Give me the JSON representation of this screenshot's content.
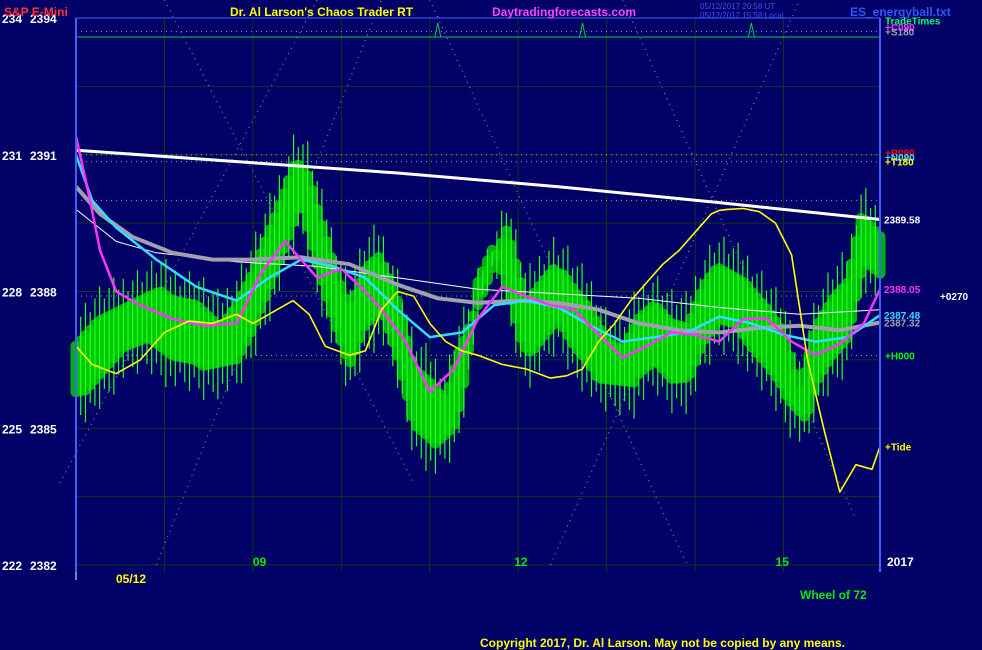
{
  "header": {
    "instrument": "S&P E-Mini",
    "app_title": "Dr. Al Larson's Chaos Trader RT",
    "website": "Daytradingforecasts.com",
    "timestamp_ut": "05/12/2017 20:58 UT",
    "timestamp_local": "05/12/2017 15:58 Local",
    "file": "ES_energyball.txt"
  },
  "footer": {
    "copyright": "Copyright 2017, Dr. Al Larson. May not be copied by any means.",
    "wheel": "Wheel of 72",
    "year": "2017",
    "date": "05/12"
  },
  "colors": {
    "background": "#000066",
    "price": "#00dd00",
    "ball": "#00cc00",
    "yellow": "#ffff00",
    "magenta": "#ff33ff",
    "cyan": "#33ddff",
    "gray": "#a0a0b0",
    "white": "#ffffff",
    "time_marker": "#00cc44"
  },
  "chart_data": {
    "type": "line",
    "xlabel": "",
    "ylabel": "",
    "ylim": [
      2382,
      2394
    ],
    "x_ticks": [
      "09",
      "12",
      "15"
    ],
    "y_ticks": [
      {
        "wheel": "222",
        "price": "2382",
        "value": 2382
      },
      {
        "wheel": "225",
        "price": "2385",
        "value": 2385
      },
      {
        "wheel": "228",
        "price": "2388",
        "value": 2388
      },
      {
        "wheel": "231",
        "price": "2391",
        "value": 2391
      },
      {
        "wheel": "234",
        "price": "2394",
        "value": 2394
      }
    ],
    "right_labels": [
      {
        "text": "TradeTimes",
        "value": 2393.95,
        "color": "#00ff66"
      },
      {
        "text": "+C090",
        "value": 2393.8,
        "color": "#ff33ff"
      },
      {
        "text": "+S180",
        "value": 2393.7,
        "color": "#a0a0b0"
      },
      {
        "text": "+R090",
        "value": 2391.05,
        "color": "#ff0000"
      },
      {
        "text": "+N090",
        "value": 2390.95,
        "color": "#33ddff"
      },
      {
        "text": "+T180",
        "value": 2390.85,
        "color": "#ffff00"
      },
      {
        "text": "2389.58",
        "value": 2389.58,
        "color": "#ffffff"
      },
      {
        "text": "2388.05",
        "value": 2388.05,
        "color": "#ff33ff"
      },
      {
        "text": "+0270",
        "value": 2387.9,
        "color": "#ffffff"
      },
      {
        "text": "2387.48",
        "value": 2387.48,
        "color": "#33ddff"
      },
      {
        "text": "2387.32",
        "value": 2387.32,
        "color": "#a0a0b0"
      },
      {
        "text": "+H000",
        "value": 2386.6,
        "color": "#00ff00"
      },
      {
        "text": "+Tide",
        "value": 2384.6,
        "color": "#ffff00"
      }
    ],
    "series": [
      {
        "key": "white",
        "x": [
          0,
          0.2,
          0.4,
          0.6,
          0.8,
          1
        ],
        "values": [
          2391.1,
          2390.85,
          2390.6,
          2390.3,
          2389.95,
          2389.58
        ]
      },
      {
        "key": "whitethin",
        "x": [
          0,
          0.05,
          0.1,
          0.2,
          0.3,
          0.4,
          0.5,
          0.6,
          0.7,
          0.8,
          0.9,
          1
        ],
        "values": [
          2389.8,
          2389.1,
          2388.85,
          2388.65,
          2388.55,
          2388.3,
          2388.05,
          2387.95,
          2387.85,
          2387.65,
          2387.5,
          2387.6
        ]
      },
      {
        "key": "gray",
        "x": [
          0,
          0.03,
          0.07,
          0.12,
          0.17,
          0.22,
          0.28,
          0.34,
          0.4,
          0.45,
          0.5,
          0.55,
          0.6,
          0.65,
          0.7,
          0.75,
          0.8,
          0.85,
          0.9,
          0.95,
          1
        ],
        "values": [
          2390.3,
          2389.7,
          2389.2,
          2388.85,
          2388.7,
          2388.7,
          2388.75,
          2388.6,
          2388.15,
          2387.85,
          2387.75,
          2387.8,
          2387.75,
          2387.6,
          2387.3,
          2387.15,
          2387.1,
          2387.2,
          2387.25,
          2387.15,
          2387.32
        ]
      },
      {
        "key": "cyan",
        "x": [
          0,
          0.02,
          0.05,
          0.1,
          0.15,
          0.2,
          0.24,
          0.28,
          0.32,
          0.36,
          0.4,
          0.44,
          0.48,
          0.52,
          0.56,
          0.6,
          0.64,
          0.68,
          0.72,
          0.76,
          0.8,
          0.84,
          0.88,
          0.92,
          0.96,
          1
        ],
        "values": [
          2391.0,
          2390.0,
          2389.4,
          2388.7,
          2388.1,
          2387.8,
          2388.3,
          2388.7,
          2388.55,
          2388.3,
          2387.6,
          2387.0,
          2387.1,
          2387.7,
          2387.8,
          2387.65,
          2387.25,
          2386.9,
          2387.0,
          2387.1,
          2387.45,
          2387.3,
          2387.05,
          2386.9,
          2387.0,
          2387.48
        ]
      },
      {
        "key": "magenta",
        "x": [
          0,
          0.015,
          0.03,
          0.05,
          0.08,
          0.12,
          0.16,
          0.2,
          0.23,
          0.26,
          0.3,
          0.33,
          0.36,
          0.38,
          0.41,
          0.44,
          0.47,
          0.5,
          0.53,
          0.56,
          0.59,
          0.62,
          0.65,
          0.68,
          0.71,
          0.74,
          0.77,
          0.8,
          0.83,
          0.86,
          0.89,
          0.92,
          0.95,
          0.98,
          1
        ],
        "values": [
          2391.4,
          2390.2,
          2388.9,
          2388.0,
          2387.7,
          2387.4,
          2387.25,
          2387.3,
          2388.4,
          2389.1,
          2388.3,
          2388.5,
          2388.0,
          2387.6,
          2386.9,
          2385.8,
          2386.3,
          2387.4,
          2388.1,
          2387.9,
          2387.7,
          2387.6,
          2387.05,
          2386.55,
          2386.8,
          2387.1,
          2387.05,
          2386.9,
          2387.4,
          2387.4,
          2386.9,
          2386.6,
          2386.85,
          2387.3,
          2388.05
        ]
      },
      {
        "key": "yellow",
        "x": [
          0,
          0.02,
          0.05,
          0.08,
          0.11,
          0.14,
          0.17,
          0.2,
          0.22,
          0.25,
          0.27,
          0.29,
          0.31,
          0.34,
          0.36,
          0.38,
          0.4,
          0.42,
          0.44,
          0.46,
          0.48,
          0.5,
          0.53,
          0.56,
          0.59,
          0.61,
          0.63,
          0.65,
          0.67,
          0.69,
          0.71,
          0.73,
          0.75,
          0.77,
          0.79,
          0.8,
          0.81,
          0.83,
          0.85,
          0.87,
          0.89,
          0.91,
          0.93,
          0.95,
          0.97,
          0.99,
          1
        ],
        "values": [
          2386.8,
          2386.4,
          2386.2,
          2386.5,
          2387.1,
          2387.35,
          2387.3,
          2387.5,
          2387.3,
          2387.6,
          2387.8,
          2387.5,
          2386.8,
          2386.6,
          2386.7,
          2387.6,
          2388.0,
          2387.9,
          2387.3,
          2386.9,
          2386.7,
          2386.6,
          2386.4,
          2386.3,
          2386.1,
          2386.15,
          2386.3,
          2386.9,
          2387.3,
          2387.8,
          2388.2,
          2388.6,
          2388.9,
          2389.3,
          2389.7,
          2389.78,
          2389.8,
          2389.82,
          2389.75,
          2389.5,
          2388.8,
          2386.5,
          2385.0,
          2383.6,
          2384.2,
          2384.1,
          2384.6
        ]
      }
    ],
    "price_path": {
      "x": [
        0,
        0.03,
        0.06,
        0.09,
        0.12,
        0.15,
        0.18,
        0.2,
        0.22,
        0.24,
        0.26,
        0.28,
        0.3,
        0.32,
        0.34,
        0.36,
        0.38,
        0.4,
        0.42,
        0.44,
        0.46,
        0.48,
        0.5,
        0.52,
        0.54,
        0.56,
        0.58,
        0.6,
        0.62,
        0.64,
        0.66,
        0.68,
        0.7,
        0.72,
        0.74,
        0.76,
        0.78,
        0.8,
        0.82,
        0.84,
        0.86,
        0.88,
        0.9,
        0.92,
        0.94,
        0.96,
        0.98,
        1
      ],
      "values": [
        2386.2,
        2386.8,
        2387.4,
        2387.6,
        2387.2,
        2387.1,
        2386.6,
        2387.1,
        2387.8,
        2388.7,
        2389.6,
        2390.6,
        2389.2,
        2388.0,
        2387.0,
        2387.9,
        2388.2,
        2387.2,
        2385.7,
        2385.4,
        2385.0,
        2386.3,
        2388.8,
        2389.6,
        2388.5,
        2387.1,
        2387.6,
        2388.0,
        2387.4,
        2387.0,
        2386.3,
        2386.1,
        2386.8,
        2387.1,
        2386.7,
        2386.6,
        2387.5,
        2388.0,
        2387.9,
        2387.4,
        2387.0,
        2386.5,
        2385.2,
        2386.6,
        2387.2,
        2387.6,
        2389.3,
        2389.0
      ]
    },
    "bands": {
      "x": [
        0,
        0.22,
        0.23,
        0.26,
        0.33,
        0.36,
        0.43,
        0.48,
        0.55,
        0.6,
        0.7,
        0.8,
        0.84,
        0.92,
        0.97,
        1
      ],
      "hi": [
        2387.1,
        2389.0,
        2390.0,
        2391.1,
        2389.7,
        2389.5,
        2386.5,
        2386.8,
        2390.0,
        2388.4,
        2387.8,
        2388.5,
        2388.1,
        2387.9,
        2389.8,
        2389.2
      ],
      "lo": [
        2385.8,
        2386.6,
        2387.0,
        2388.0,
        2386.9,
        2385.0,
        2384.4,
        2385.2,
        2386.9,
        2386.2,
        2386.0,
        2386.2,
        2386.5,
        2385.0,
        2386.2,
        2388.3
      ]
    },
    "trade_time_spikes": [
      0.45,
      0.63,
      0.84
    ],
    "vertical_grid": [
      0.11,
      0.22,
      0.33,
      0.44,
      0.55,
      0.66,
      0.77,
      0.88
    ],
    "horizontal_grid": [
      2382,
      2383.5,
      2385,
      2386.5,
      2388,
      2389.5,
      2391,
      2392.5,
      2394
    ],
    "dotted_levels": [
      2393.7,
      2391.0,
      2390.85,
      2390.0,
      2387.9,
      2386.6
    ],
    "diagonals": [
      {
        "x1": -0.02,
        "v1": 2383.8,
        "x2": 0.3,
        "v2": 2394.4
      },
      {
        "x1": 0.11,
        "v1": 2394.4,
        "x2": 0.42,
        "v2": 2383.8
      },
      {
        "x1": 0.1,
        "v1": 2382.0,
        "x2": 0.38,
        "v2": 2394.4
      },
      {
        "x1": 0.44,
        "v1": 2394.4,
        "x2": 0.76,
        "v2": 2382.0
      },
      {
        "x1": 0.59,
        "v1": 2382.0,
        "x2": 0.9,
        "v2": 2394.4
      },
      {
        "x1": 0.68,
        "v1": 2394.4,
        "x2": 0.97,
        "v2": 2383.0
      }
    ]
  }
}
